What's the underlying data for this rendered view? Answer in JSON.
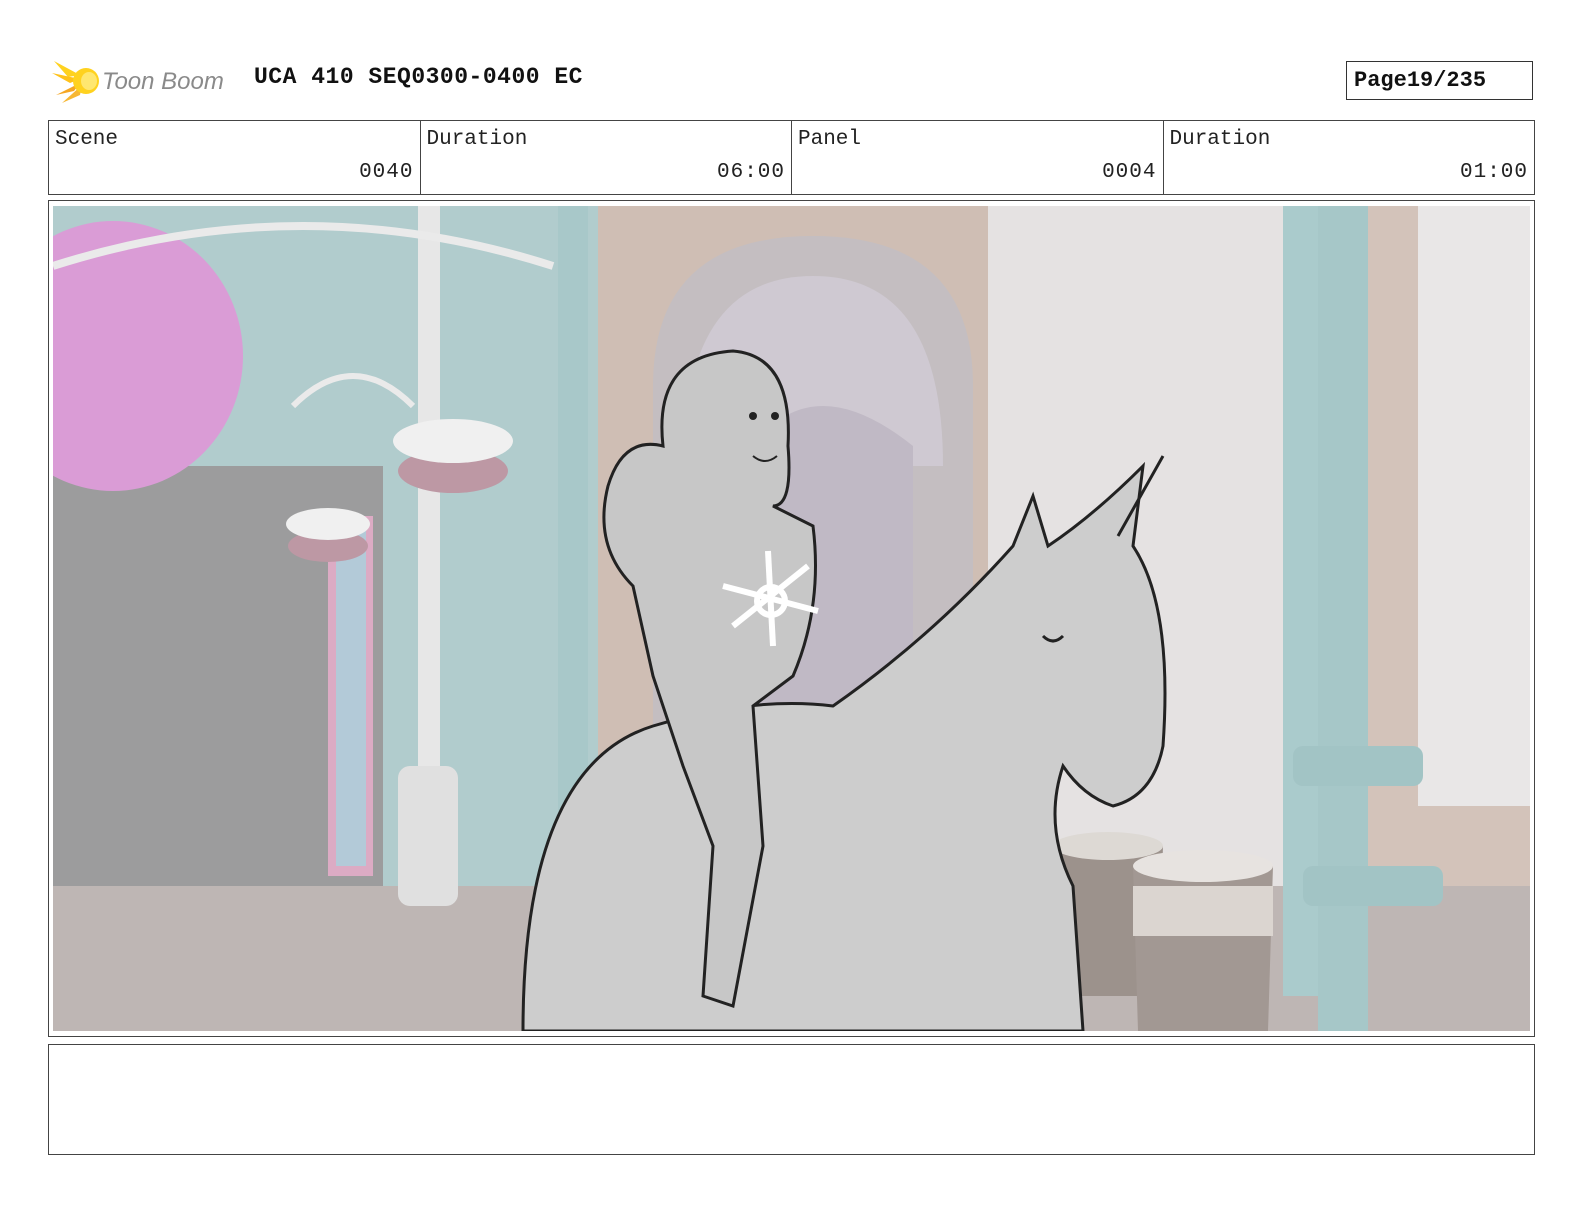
{
  "header": {
    "logo_text": "Toon Boom",
    "title": "UCA 410 SEQ0300-0400 EC",
    "page_label": "Page",
    "page_number": "19/235"
  },
  "info": {
    "scene_label": "Scene",
    "scene_value": "0040",
    "scene_duration_label": "Duration",
    "scene_duration_value": "06:00",
    "panel_label": "Panel",
    "panel_value": "0004",
    "panel_duration_label": "Duration",
    "panel_duration_value": "01:00"
  },
  "panel": {
    "image_description_icon": "storyboard-sketch-image"
  },
  "notes": {
    "text": ""
  },
  "colors": {
    "logo_orange": "#f5a623",
    "logo_yellow": "#ffd21f",
    "logo_text": "#8a8a8a",
    "frame_border": "#444444",
    "bg_teal": "#9fc7c9",
    "bg_pink": "#d98ad5",
    "bg_tan": "#c8b4a8",
    "sketch_fill": "#cfcfcf"
  }
}
